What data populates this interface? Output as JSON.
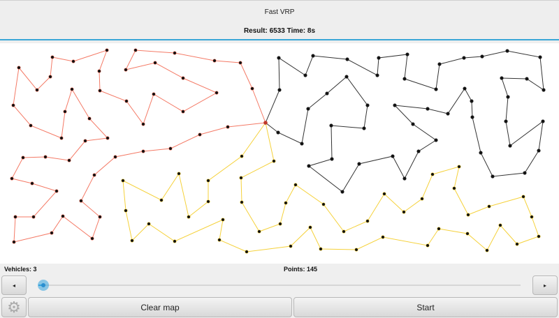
{
  "header": {
    "title": "Fast VRP",
    "result": "Result: 6533 Time: 8s"
  },
  "status": {
    "vehicles": "Vehicles: 3",
    "points": "Points: 145"
  },
  "slider": {
    "value_fraction": 0.01,
    "decrement_label": "◂",
    "increment_label": "▸"
  },
  "buttons": {
    "settings_icon": "⚙",
    "clear_map": "Clear map",
    "start": "Start"
  },
  "colors": {
    "accent": "#3aa6d6",
    "route_1": "#f47a66",
    "route_2": "#333333",
    "route_3": "#f5d13a",
    "point": "#111111"
  }
}
